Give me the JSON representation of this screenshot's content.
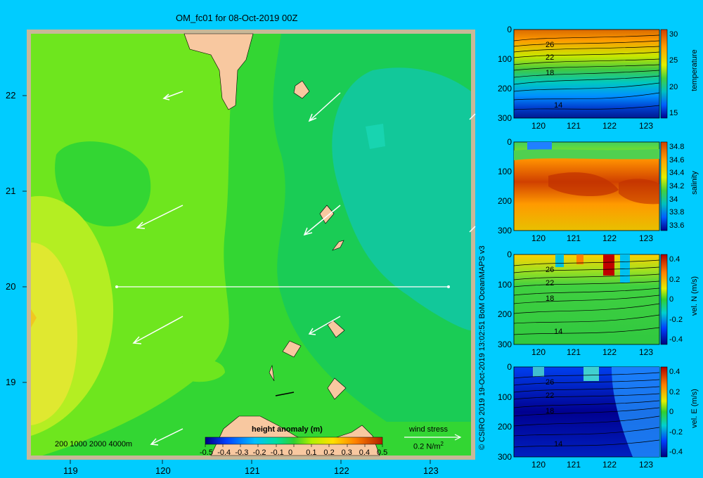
{
  "title": "OM_fc01 for 08-Oct-2019 00Z",
  "credit": "© CSIRO 2019  19-Oct-2019 13:02:51 BoM OceanMAPS v3",
  "map": {
    "lon_ticks": [
      "119",
      "120",
      "121",
      "122",
      "123"
    ],
    "lat_ticks": [
      "22",
      "21",
      "20",
      "19"
    ],
    "depth_legend": "200  1000  2000  4000m",
    "wind_label": "wind stress",
    "wind_scale": "0.2 N/m",
    "wind_scale_exp": "2",
    "colorbar_title": "height anomaly  (m)",
    "colorbar_ticks": [
      "-0.5",
      "-0.4",
      "-0.3",
      "-0.2",
      "-0.1",
      "0",
      "0.1",
      "0.2",
      "0.3",
      "0.4",
      "0.5"
    ],
    "section_line": {
      "lat": 20,
      "lon_start": 119.5,
      "lon_end": 123.2
    }
  },
  "panels": [
    {
      "label": "temperature",
      "cb_ticks": [
        "30",
        "25",
        "20",
        "15"
      ],
      "contours": [
        "26",
        "22",
        "18",
        "14"
      ]
    },
    {
      "label": "salinity",
      "cb_ticks": [
        "34.8",
        "34.6",
        "34.4",
        "34.2",
        "34",
        "33.8",
        "33.6"
      ],
      "contours": []
    },
    {
      "label": "vel. N (m/s)",
      "cb_ticks": [
        "0.4",
        "0.2",
        "0",
        "-0.2",
        "-0.4"
      ],
      "contours": [
        "26",
        "22",
        "18",
        "14"
      ]
    },
    {
      "label": "vel. E (m/s)",
      "cb_ticks": [
        "0.4",
        "0.2",
        "0",
        "-0.2",
        "-0.4"
      ],
      "contours": [
        "26",
        "22",
        "18",
        "14"
      ]
    }
  ],
  "panel_axes": {
    "x_ticks": [
      "120",
      "121",
      "122",
      "123"
    ],
    "y_ticks": [
      "0",
      "100",
      "200",
      "300"
    ]
  },
  "colors": {
    "background": "#00ccff",
    "land": "#f8c8a0",
    "frame": "#c8b898",
    "ssh_low": "#00c8a0",
    "ssh_mid": "#22cc33",
    "ssh_high": "#e0e830"
  }
}
